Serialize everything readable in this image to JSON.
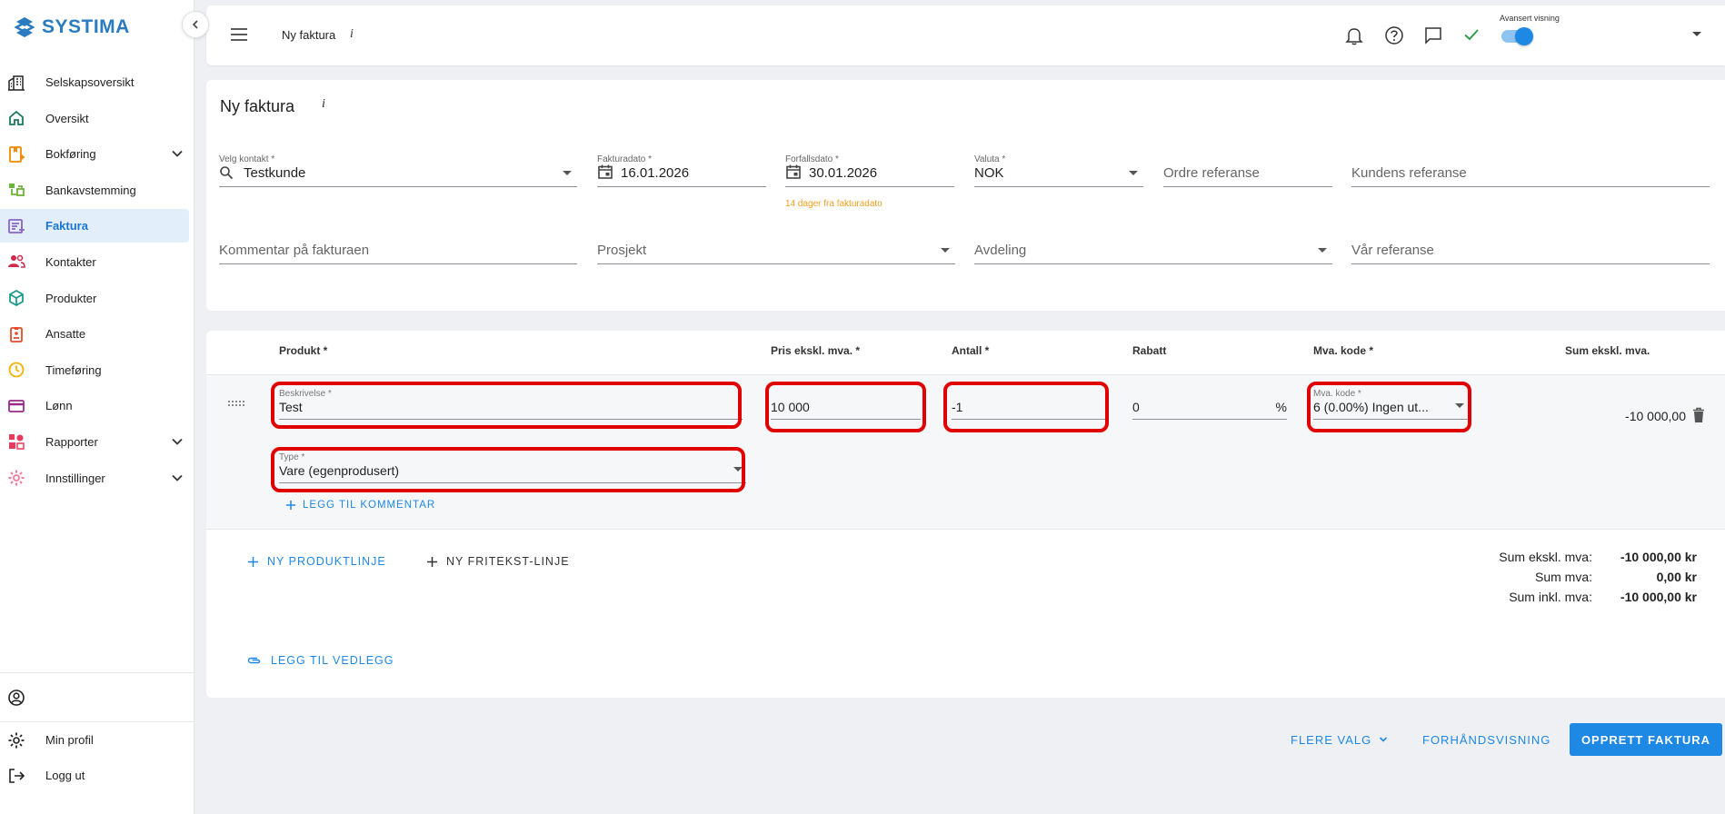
{
  "brand": {
    "name": "SYSTIMA",
    "color": "#2a7bc0"
  },
  "sidebar": {
    "items": [
      {
        "label": "Selskapsoversikt",
        "icon": "buildings-icon"
      },
      {
        "label": "Oversikt",
        "icon": "home-icon"
      },
      {
        "label": "Bokføring",
        "icon": "bookkeeping-icon",
        "expandable": true
      },
      {
        "label": "Bankavstemming",
        "icon": "bank-icon"
      },
      {
        "label": "Faktura",
        "icon": "invoice-icon",
        "active": true
      },
      {
        "label": "Kontakter",
        "icon": "contacts-icon"
      },
      {
        "label": "Produkter",
        "icon": "box-icon"
      },
      {
        "label": "Ansatte",
        "icon": "badge-icon"
      },
      {
        "label": "Timeføring",
        "icon": "clock-icon"
      },
      {
        "label": "Lønn",
        "icon": "card-icon"
      },
      {
        "label": "Rapporter",
        "icon": "reports-icon",
        "expandable": true
      },
      {
        "label": "Innstillinger",
        "icon": "settings-icon",
        "expandable": true
      }
    ],
    "bottom": [
      {
        "label": "Min profil",
        "icon": "gear-icon"
      },
      {
        "label": "Logg ut",
        "icon": "logout-icon"
      }
    ]
  },
  "topbar": {
    "title": "Ny faktura",
    "info": "i",
    "advanced_label": "Avansert visning",
    "advanced_on": true
  },
  "form": {
    "title": "Ny faktura",
    "info": "i",
    "contact": {
      "label": "Velg kontakt *",
      "value": "Testkunde"
    },
    "invoice_date": {
      "label": "Fakturadato *",
      "value": "16.01.2026"
    },
    "due_date": {
      "label": "Forfallsdato *",
      "value": "30.01.2026",
      "helper": "14 dager fra fakturadato"
    },
    "currency": {
      "label": "Valuta *",
      "value": "NOK"
    },
    "order_ref": {
      "placeholder": "Ordre referanse"
    },
    "customer_ref": {
      "placeholder": "Kundens referanse"
    },
    "comment": {
      "placeholder": "Kommentar på fakturaen"
    },
    "project": {
      "placeholder": "Prosjekt"
    },
    "department": {
      "placeholder": "Avdeling"
    },
    "our_ref": {
      "placeholder": "Vår referanse"
    }
  },
  "products": {
    "headers": {
      "product": "Produkt *",
      "price": "Pris ekskl. mva. *",
      "qty": "Antall *",
      "discount": "Rabatt",
      "vat": "Mva. kode *",
      "sum": "Sum ekskl. mva."
    },
    "row": {
      "description_label": "Beskrivelse *",
      "description": "Test",
      "price": "10 000",
      "qty": "-1",
      "discount": "0",
      "discount_unit": "%",
      "vat_label": "Mva. kode *",
      "vat": "6 (0.00%) Ingen ut...",
      "sum": "-10 000,00",
      "type_label": "Type *",
      "type": "Vare (egenprodusert)",
      "add_comment": "Legg til kommentar"
    },
    "new_product_line": "Ny produktlinje",
    "new_text_line": "Ny fritekst-linje",
    "attach": "Legg til vedlegg",
    "totals": [
      {
        "label": "Sum ekskl. mva:",
        "value": "-10 000,00 kr"
      },
      {
        "label": "Sum mva:",
        "value": "0,00 kr"
      },
      {
        "label": "Sum inkl. mva:",
        "value": "-10 000,00 kr"
      }
    ]
  },
  "actions": {
    "more": "Flere valg",
    "preview": "Forhåndsvisning",
    "create": "Opprett faktura"
  },
  "colors": {
    "accent": "#1e88e5",
    "highlight": "#e00000",
    "helper": "#f0a020"
  }
}
